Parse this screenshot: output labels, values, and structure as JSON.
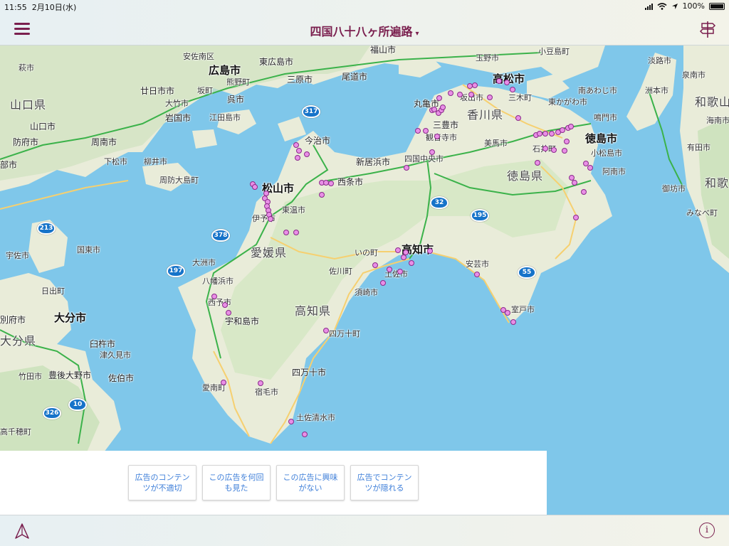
{
  "status_bar": {
    "time": "11:55",
    "date": "2月10日(水)",
    "battery": "100%"
  },
  "nav": {
    "title": "四国八十八ヶ所遍路",
    "caret": "▾",
    "menu_icon": "hamburger-icon",
    "route_icon": "signpost-icon"
  },
  "colors": {
    "accent": "#7a1f4e",
    "sea": "#7fc7ea",
    "land": "#e9ecd9",
    "forest": "#cfe3bf",
    "pin": "#e98fe6",
    "highway": "#3bb24a",
    "road": "#f6d070"
  },
  "map": {
    "cities": [
      {
        "name": "広島市",
        "size": "major"
      },
      {
        "name": "松山市",
        "size": "major"
      },
      {
        "name": "高松市",
        "size": "major"
      },
      {
        "name": "高知市",
        "size": "major"
      },
      {
        "name": "徳島市",
        "size": "major"
      },
      {
        "name": "大分市",
        "size": "major"
      },
      {
        "name": "福山市",
        "size": "city"
      },
      {
        "name": "安佐南区",
        "size": "small"
      },
      {
        "name": "東広島市",
        "size": "city"
      },
      {
        "name": "萩市",
        "size": "small"
      },
      {
        "name": "廿日市市",
        "size": "city"
      },
      {
        "name": "坂町",
        "size": "small"
      },
      {
        "name": "熊野町",
        "size": "small"
      },
      {
        "name": "三原市",
        "size": "city"
      },
      {
        "name": "尾道市",
        "size": "city"
      },
      {
        "name": "玉野市",
        "size": "small"
      },
      {
        "name": "小豆島町",
        "size": "small"
      },
      {
        "name": "淡路市",
        "size": "city"
      },
      {
        "name": "泉南市",
        "size": "small"
      },
      {
        "name": "山口県",
        "size": "pref"
      },
      {
        "name": "大竹市",
        "size": "small"
      },
      {
        "name": "呉市",
        "size": "city"
      },
      {
        "name": "岩国市",
        "size": "city"
      },
      {
        "name": "江田島市",
        "size": "small"
      },
      {
        "name": "丸亀市",
        "size": "city"
      },
      {
        "name": "坂出市",
        "size": "small"
      },
      {
        "name": "三木町",
        "size": "small"
      },
      {
        "name": "南あわじ市",
        "size": "small"
      },
      {
        "name": "洲本市",
        "size": "small"
      },
      {
        "name": "和歌山",
        "size": "pref"
      },
      {
        "name": "山口市",
        "size": "city"
      },
      {
        "name": "香川県",
        "size": "pref"
      },
      {
        "name": "東かがわ市",
        "size": "small"
      },
      {
        "name": "鳴門市",
        "size": "small"
      },
      {
        "name": "海南市",
        "size": "small"
      },
      {
        "name": "三豊市",
        "size": "city"
      },
      {
        "name": "観音寺市",
        "size": "small"
      },
      {
        "name": "美馬市",
        "size": "small"
      },
      {
        "name": "防府市",
        "size": "city"
      },
      {
        "name": "周南市",
        "size": "city"
      },
      {
        "name": "今治市",
        "size": "city"
      },
      {
        "name": "石井町",
        "size": "small"
      },
      {
        "name": "小松島市",
        "size": "small"
      },
      {
        "name": "有田市",
        "size": "small"
      },
      {
        "name": "部市",
        "size": "city"
      },
      {
        "name": "下松市",
        "size": "small"
      },
      {
        "name": "柳井市",
        "size": "small"
      },
      {
        "name": "新居浜市",
        "size": "city"
      },
      {
        "name": "四国中央市",
        "size": "small"
      },
      {
        "name": "阿南市",
        "size": "small"
      },
      {
        "name": "周防大島町",
        "size": "small"
      },
      {
        "name": "西条市",
        "size": "city"
      },
      {
        "name": "徳島県",
        "size": "pref"
      },
      {
        "name": "御坊市",
        "size": "small"
      },
      {
        "name": "和歌",
        "size": "pref"
      },
      {
        "name": "東温市",
        "size": "small"
      },
      {
        "name": "みなべ町",
        "size": "small"
      },
      {
        "name": "伊予市",
        "size": "small"
      },
      {
        "name": "宇佐市",
        "size": "small"
      },
      {
        "name": "国東市",
        "size": "small"
      },
      {
        "name": "愛媛県",
        "size": "pref"
      },
      {
        "name": "いの町",
        "size": "small"
      },
      {
        "name": "大洲市",
        "size": "small"
      },
      {
        "name": "安芸市",
        "size": "small"
      },
      {
        "name": "佐川町",
        "size": "small"
      },
      {
        "name": "土佐市",
        "size": "small"
      },
      {
        "name": "日出町",
        "size": "small"
      },
      {
        "name": "八幡浜市",
        "size": "small"
      },
      {
        "name": "須崎市",
        "size": "small"
      },
      {
        "name": "室戸市",
        "size": "small"
      },
      {
        "name": "西予市",
        "size": "small"
      },
      {
        "name": "高知県",
        "size": "pref"
      },
      {
        "name": "別府市",
        "size": "small"
      },
      {
        "name": "宇和島市",
        "size": "small"
      },
      {
        "name": "大分県",
        "size": "pref"
      },
      {
        "name": "四万十町",
        "size": "small"
      },
      {
        "name": "臼杵市",
        "size": "small"
      },
      {
        "name": "津久見市",
        "size": "small"
      },
      {
        "name": "竹田市",
        "size": "small"
      },
      {
        "name": "豊後大野市",
        "size": "small"
      },
      {
        "name": "佐伯市",
        "size": "small"
      },
      {
        "name": "四万十市",
        "size": "small"
      },
      {
        "name": "愛南町",
        "size": "small"
      },
      {
        "name": "宿毛市",
        "size": "small"
      },
      {
        "name": "土佐清水市",
        "size": "small"
      },
      {
        "name": "高千穂町",
        "size": "small"
      }
    ],
    "shields": [
      "317",
      "32",
      "195",
      "213",
      "378",
      "197",
      "55",
      "326",
      "10"
    ]
  },
  "ad_feedback": {
    "buttons": [
      {
        "label": "広告のコンテンツが不適切"
      },
      {
        "label": "この広告を何回も見た"
      },
      {
        "label": "この広告に興味がない"
      },
      {
        "label": "広告でコンテンツが隠れる"
      }
    ]
  },
  "toolbar": {
    "locate_icon": "location-arrow-icon",
    "info_icon": "info-icon",
    "info_glyph": "i"
  }
}
